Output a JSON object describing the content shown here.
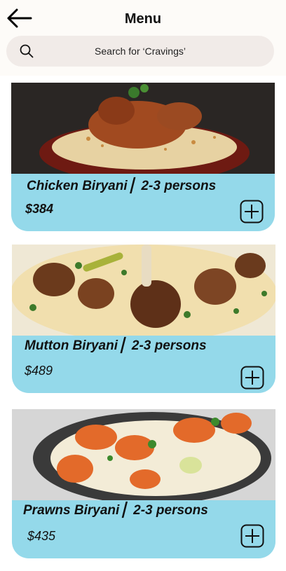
{
  "header": {
    "title": "Menu",
    "back_icon": "arrow-left-icon"
  },
  "search": {
    "placeholder": "Search for ‘Cravings’",
    "icon": "search-icon"
  },
  "items": [
    {
      "name": "Chicken Biryani  ▏2-3 persons",
      "price": "$384",
      "add_icon": "plus-square-icon"
    },
    {
      "name": "Mutton Biryani  ▏2-3 persons",
      "price": "$489",
      "add_icon": "plus-square-icon"
    },
    {
      "name": "Prawns Biryani  ▏2-3 persons",
      "price": "$435",
      "add_icon": "plus-square-icon"
    }
  ],
  "colors": {
    "card": "#94d9ea",
    "search_bg": "#f1ebe8",
    "header_bg": "#fdfbf8"
  }
}
